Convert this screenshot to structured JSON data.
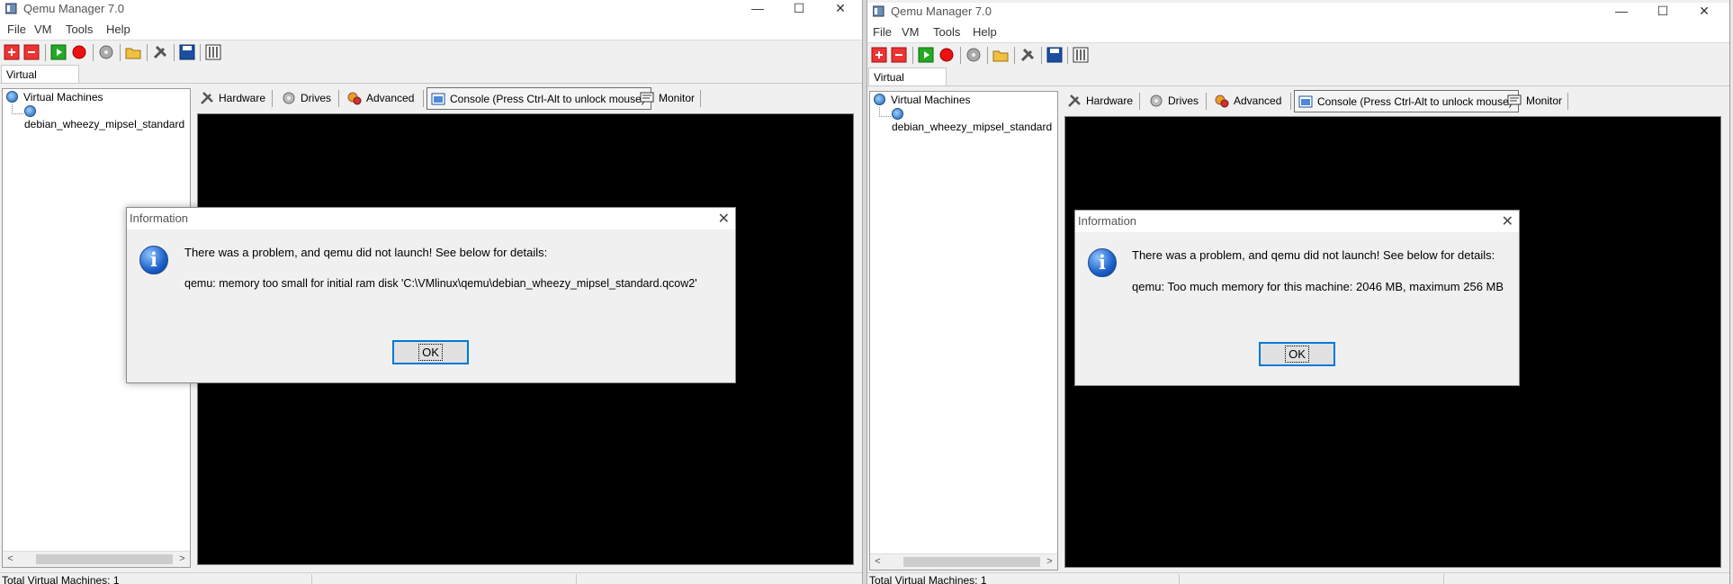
{
  "left": {
    "title": "Qemu Manager 7.0",
    "menu": [
      "File",
      "VM",
      "Tools",
      "Help"
    ],
    "vm_tab": "Virtual Machines",
    "tree_root": "Virtual Machines",
    "tree_child": "debian_wheezy_mipsel_standard",
    "tabs": {
      "hardware": "Hardware",
      "drives": "Drives",
      "advanced": "Advanced",
      "console": "Console (Press Ctrl-Alt to unlock mouse)",
      "monitor": "Monitor"
    },
    "status": "Total Virtual Machines: 1",
    "dialog": {
      "title": "Information",
      "message": "There was a problem, and qemu did not launch! See below for details:",
      "detail": "qemu: memory too small for initial ram disk 'C:\\VMlinux\\qemu\\debian_wheezy_mipsel_standard.qcow2'",
      "ok": "OK"
    }
  },
  "right": {
    "title": "Qemu Manager 7.0",
    "menu": [
      "File",
      "VM",
      "Tools",
      "Help"
    ],
    "vm_tab": "Virtual Machines",
    "tree_root": "Virtual Machines",
    "tree_child": "debian_wheezy_mipsel_standard",
    "tabs": {
      "hardware": "Hardware",
      "drives": "Drives",
      "advanced": "Advanced",
      "console": "Console (Press Ctrl-Alt to unlock mouse)",
      "monitor": "Monitor"
    },
    "status": "Total Virtual Machines: 1",
    "dialog": {
      "title": "Information",
      "message": "There was a problem, and qemu did not launch! See below for details:",
      "detail": "qemu: Too much memory for this machine: 2046 MB, maximum 256 MB",
      "ok": "OK"
    }
  },
  "window_controls": {
    "minimize": "—",
    "maximize": "☐",
    "close": "✕"
  },
  "icons": [
    "new-vm-icon",
    "delete-vm-icon",
    "start-vm-icon",
    "stop-vm-icon",
    "disk-icon",
    "open-folder-icon",
    "tools-icon",
    "save-icon",
    "keyboard-icon"
  ],
  "colors": {
    "console_bg": "#000000",
    "ok_border": "#0078d7",
    "window_bg": "#f0f0f0"
  }
}
